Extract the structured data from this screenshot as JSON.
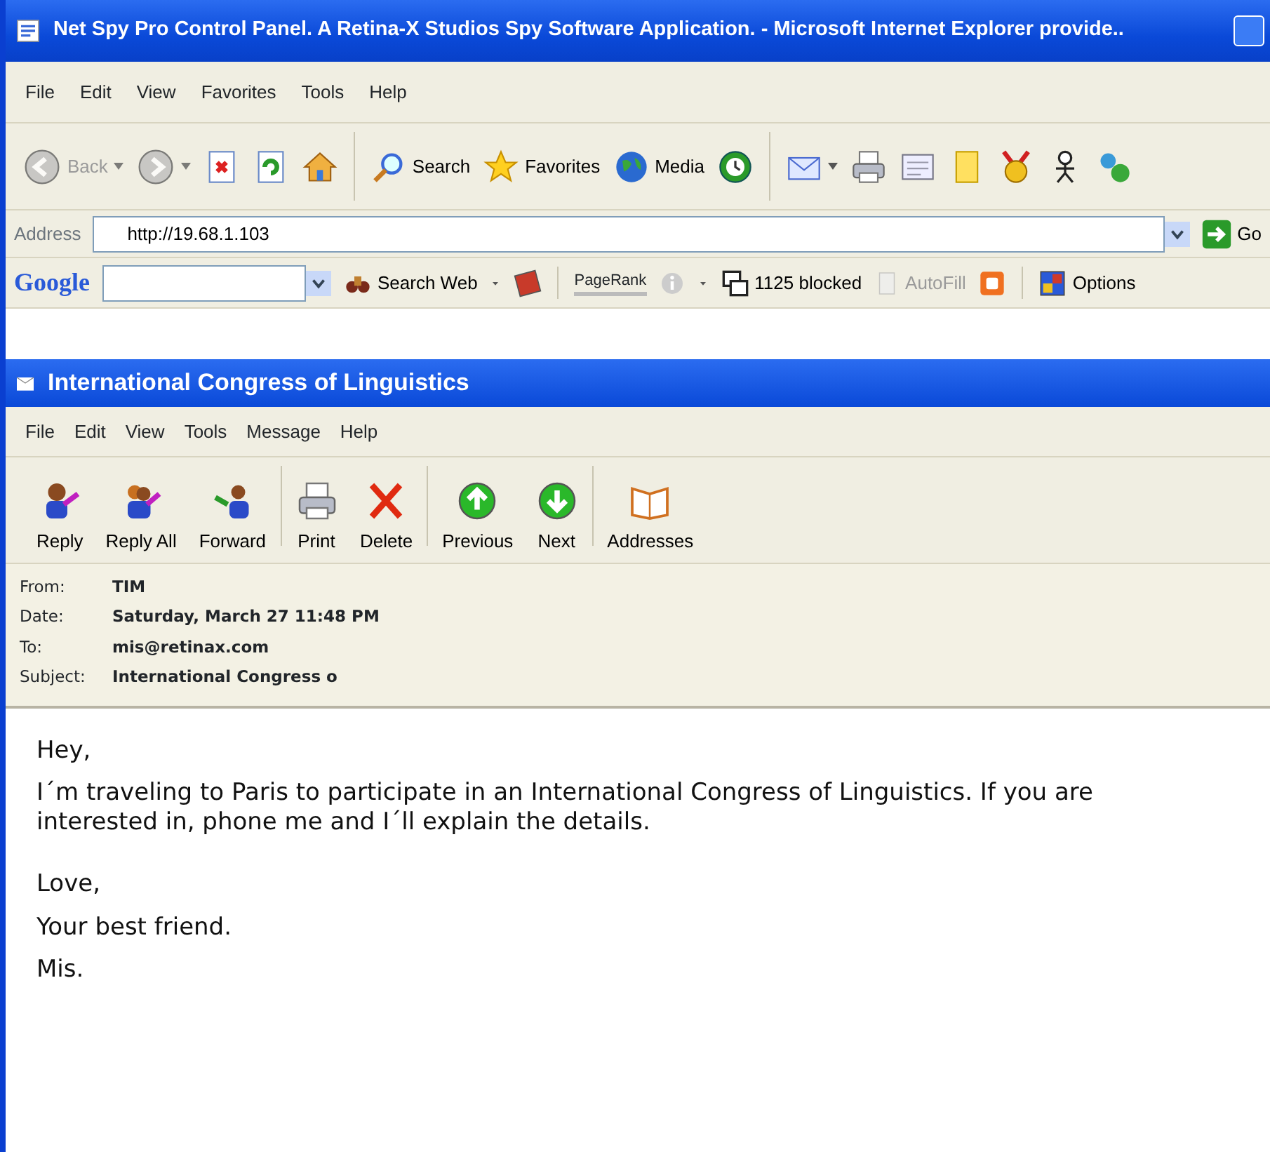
{
  "browser": {
    "title": "Net Spy Pro Control Panel. A Retina-X Studios Spy Software Application. - Microsoft Internet Explorer provide..",
    "menu": [
      "File",
      "Edit",
      "View",
      "Favorites",
      "Tools",
      "Help"
    ],
    "toolbar": [
      {
        "kind": "back",
        "label": "Back",
        "disabled": true,
        "dropdown": true
      },
      {
        "kind": "forward",
        "disabled": true,
        "dropdown": true
      },
      {
        "kind": "stop",
        "disabled": false,
        "dropdown": false
      },
      {
        "kind": "refresh",
        "disabled": false,
        "dropdown": false
      },
      {
        "kind": "home",
        "disabled": false,
        "dropdown": false
      },
      {
        "kind": "search",
        "label": "Search",
        "disabled": false,
        "dropdown": false
      },
      {
        "kind": "favorites",
        "label": "Favorites",
        "disabled": false,
        "dropdown": false
      },
      {
        "kind": "media",
        "label": "Media",
        "disabled": false,
        "dropdown": false
      },
      {
        "kind": "history",
        "disabled": false,
        "dropdown": false
      },
      {
        "kind": "mail",
        "disabled": false,
        "dropdown": true
      },
      {
        "kind": "print",
        "disabled": false,
        "dropdown": false
      },
      {
        "kind": "edit",
        "disabled": false,
        "dropdown": false
      },
      {
        "kind": "note",
        "disabled": false,
        "dropdown": false
      },
      {
        "kind": "badge",
        "disabled": false,
        "dropdown": false
      },
      {
        "kind": "person",
        "disabled": false,
        "dropdown": false
      },
      {
        "kind": "network",
        "disabled": false,
        "dropdown": false
      }
    ],
    "address": {
      "label": "Address",
      "value": "http://19.68.1.103",
      "go": "Go"
    },
    "google_bar": {
      "logo": "Google",
      "search_web": "Search Web",
      "pagerank": "PageRank",
      "blocked": "1125 blocked",
      "autofill": "AutoFill",
      "options": "Options"
    }
  },
  "message": {
    "title": "International Congress of Linguistics",
    "menu": [
      "File",
      "Edit",
      "View",
      "Tools",
      "Message",
      "Help"
    ],
    "toolbar": [
      {
        "kind": "reply",
        "label": "Reply"
      },
      {
        "kind": "reply-all",
        "label": "Reply All"
      },
      {
        "kind": "forward",
        "label": "Forward"
      },
      {
        "kind": "print",
        "label": "Print"
      },
      {
        "kind": "delete",
        "label": "Delete"
      },
      {
        "kind": "previous",
        "label": "Previous"
      },
      {
        "kind": "next",
        "label": "Next"
      },
      {
        "kind": "addresses",
        "label": "Addresses"
      }
    ],
    "headers": [
      {
        "label": "From:",
        "value": "TIM"
      },
      {
        "label": "Date:",
        "value": "Saturday, March 27 11:48 PM"
      },
      {
        "label": "To:",
        "value": "mis@retinax.com"
      },
      {
        "label": "Subject:",
        "value": "International Congress o"
      }
    ],
    "body": [
      [
        "Hey,",
        "I´m traveling to Paris to participate in an International Congress of Linguistics. If you are interested in, phone me and I´ll explain the details."
      ],
      [
        "Love,",
        "Your best friend.",
        "Mis."
      ]
    ]
  }
}
